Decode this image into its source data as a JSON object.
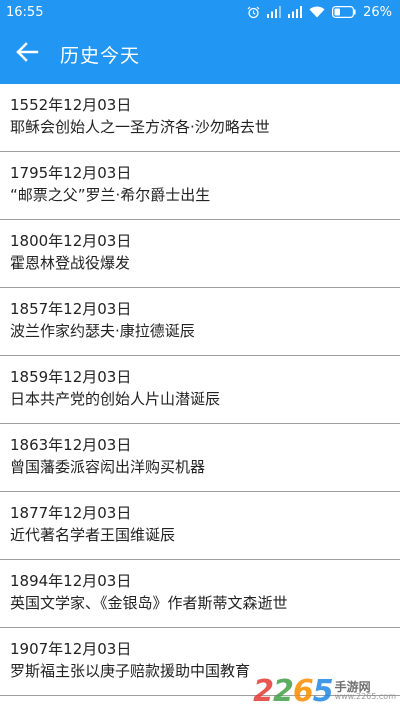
{
  "status_bar": {
    "time": "16:55",
    "battery": "26%"
  },
  "app_bar": {
    "title": "历史今天"
  },
  "events": [
    {
      "date": "1552年12月03日",
      "text": "耶稣会创始人之一圣方济各·沙勿略去世"
    },
    {
      "date": "1795年12月03日",
      "text": "“邮票之父”罗兰·希尔爵士出生"
    },
    {
      "date": "1800年12月03日",
      "text": "霍恩林登战役爆发"
    },
    {
      "date": "1857年12月03日",
      "text": "波兰作家约瑟夫·康拉德诞辰"
    },
    {
      "date": "1859年12月03日",
      "text": "日本共产党的创始人片山潜诞辰"
    },
    {
      "date": "1863年12月03日",
      "text": "曾国藩委派容闳出洋购买机器"
    },
    {
      "date": "1877年12月03日",
      "text": "近代著名学者王国维诞辰"
    },
    {
      "date": "1894年12月03日",
      "text": "英国文学家、《金银岛》作者斯蒂文森逝世"
    },
    {
      "date": "1907年12月03日",
      "text": "罗斯福主张以庚子赔款援助中国教育"
    }
  ],
  "watermark": {
    "number": "2265",
    "label": "手游网",
    "url": "www.2265.com"
  },
  "colors": {
    "primary": "#2196f3",
    "divider": "#9e9e9e"
  }
}
